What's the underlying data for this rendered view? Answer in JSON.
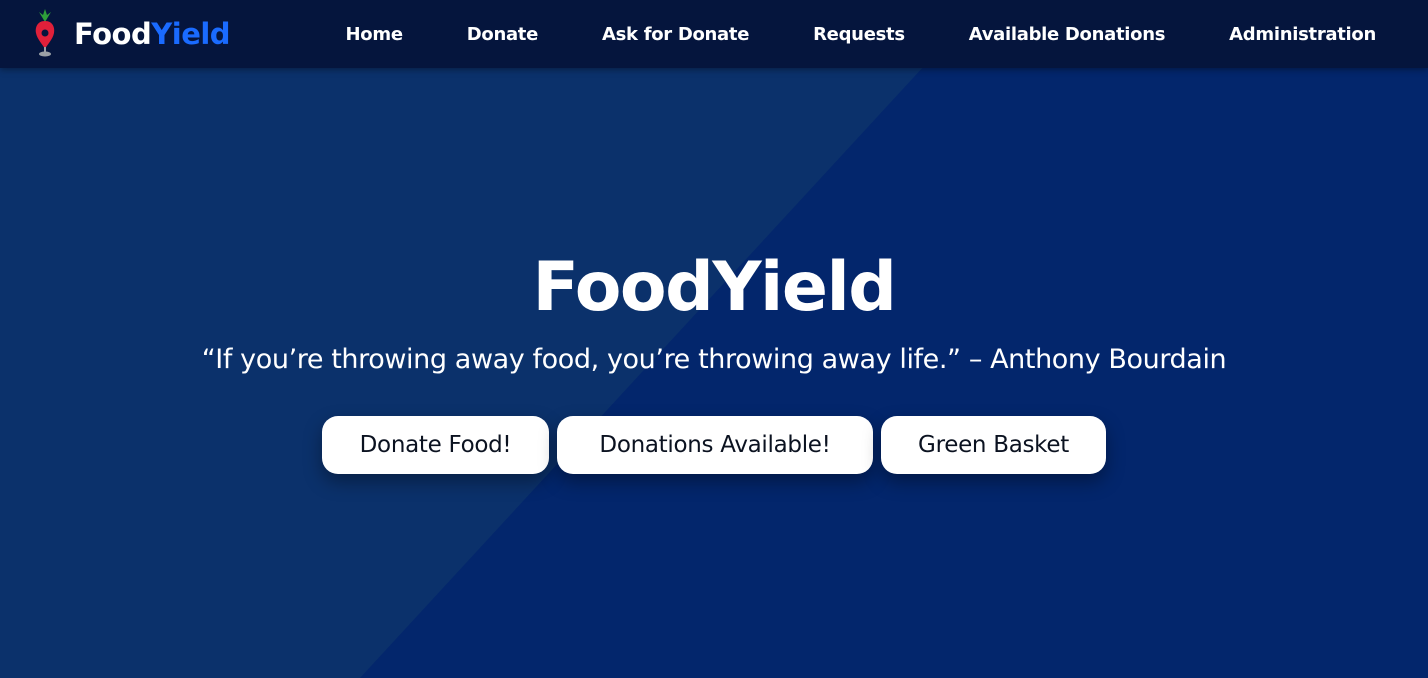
{
  "brand": {
    "name_part1": "Food",
    "name_part2": "Yield",
    "logo_icon": "radish-pin-icon"
  },
  "nav": {
    "items": [
      {
        "label": "Home"
      },
      {
        "label": "Donate"
      },
      {
        "label": "Ask for Donate"
      },
      {
        "label": "Requests"
      },
      {
        "label": "Available Donations"
      },
      {
        "label": "Administration"
      }
    ]
  },
  "hero": {
    "title": "FoodYield",
    "quote": "“If you’re throwing away food, you’re throwing away life.” – Anthony Bourdain",
    "buttons": [
      {
        "label": "Donate Food!"
      },
      {
        "label": "Donations Available!"
      },
      {
        "label": "Green Basket"
      }
    ]
  },
  "colors": {
    "navbar_bg": "#05153d",
    "hero_bg": "#03266c",
    "brand_accent": "#1a6bff",
    "button_bg": "#ffffff"
  }
}
